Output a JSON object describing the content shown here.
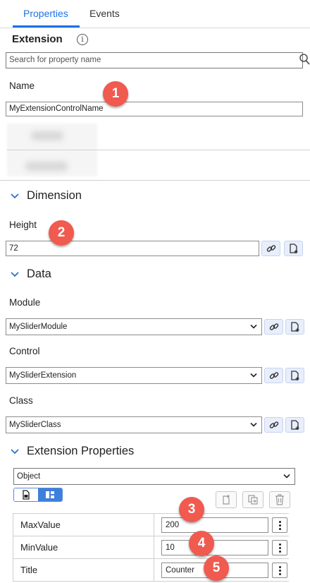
{
  "tabs": [
    {
      "label": "Properties",
      "active": true
    },
    {
      "label": "Events",
      "active": false
    }
  ],
  "section": {
    "title": "Extension",
    "info_icon": "info-icon"
  },
  "search": {
    "placeholder": "Search for property name",
    "icon": "search-icon"
  },
  "name_field": {
    "label": "Name",
    "value": "MyExtensionControlName"
  },
  "groups": {
    "dimension": {
      "title": "Dimension",
      "height_label": "Height",
      "height_value": "72"
    },
    "data": {
      "title": "Data",
      "module_label": "Module",
      "module_value": "MySliderModule",
      "control_label": "Control",
      "control_value": "MySliderExtension",
      "class_label": "Class",
      "class_value": "MySliderClass"
    },
    "extension_properties": {
      "title": "Extension Properties",
      "type_value": "Object",
      "rows": [
        {
          "name": "MaxValue",
          "value": "200"
        },
        {
          "name": "MinValue",
          "value": "10"
        },
        {
          "name": "Title",
          "value": "Counter"
        }
      ]
    }
  },
  "markers": [
    "1",
    "2",
    "3",
    "4",
    "5"
  ],
  "colors": {
    "accent": "#1a73e8",
    "marker": "#f05a4f",
    "toggle_on": "#3d7fdc"
  }
}
